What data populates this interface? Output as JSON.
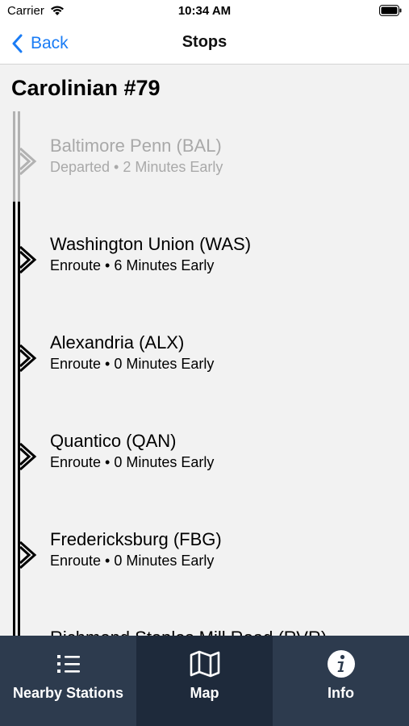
{
  "status_bar": {
    "carrier": "Carrier",
    "time": "10:34 AM"
  },
  "nav": {
    "back_label": "Back",
    "title": "Stops"
  },
  "train": {
    "title": "Carolinian #79"
  },
  "colors": {
    "accent": "#1a7cf5",
    "tab_bar": "#2d3b4e",
    "tab_active": "#1e2a3b",
    "departed": "#a9a9a9"
  },
  "stops": [
    {
      "name": "Baltimore Penn (BAL)",
      "status": "Departed • 2 Minutes Early",
      "state": "departed"
    },
    {
      "name": "Washington Union (WAS)",
      "status": "Enroute • 6 Minutes Early",
      "state": "enroute"
    },
    {
      "name": "Alexandria (ALX)",
      "status": "Enroute • 0 Minutes Early",
      "state": "enroute"
    },
    {
      "name": "Quantico (QAN)",
      "status": "Enroute • 0 Minutes Early",
      "state": "enroute"
    },
    {
      "name": "Fredericksburg (FBG)",
      "status": "Enroute • 0 Minutes Early",
      "state": "enroute"
    },
    {
      "name": "Richmond Staples Mill Road (RVR)",
      "status": "",
      "state": "enroute"
    }
  ],
  "tabs": [
    {
      "label": "Nearby Stations",
      "icon": "list-icon",
      "active": false
    },
    {
      "label": "Map",
      "icon": "map-icon",
      "active": true
    },
    {
      "label": "Info",
      "icon": "info-icon",
      "active": false
    }
  ]
}
